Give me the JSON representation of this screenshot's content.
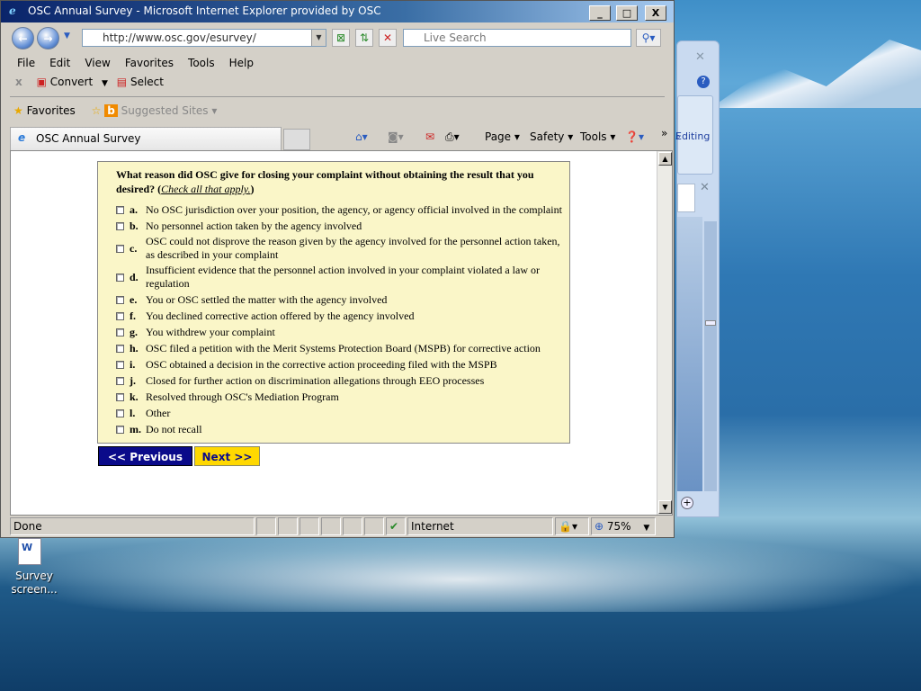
{
  "window": {
    "title": "OSC Annual Survey - Microsoft Internet Explorer provided by OSC",
    "minimize": "_",
    "maximize": "□",
    "close": "X"
  },
  "address": {
    "url": "http://www.osc.gov/esurvey/",
    "search_placeholder": "Live Search"
  },
  "menu": [
    "File",
    "Edit",
    "View",
    "Favorites",
    "Tools",
    "Help"
  ],
  "toolbar2": {
    "close": "x",
    "convert": "Convert",
    "select": "Select"
  },
  "favorites": {
    "label": "Favorites",
    "suggested": "Suggested Sites ▾"
  },
  "tab": {
    "label": "OSC Annual Survey"
  },
  "commands": {
    "page": "Page ▾",
    "safety": "Safety ▾",
    "tools": "Tools ▾",
    "more": "»"
  },
  "survey": {
    "question": "What reason did OSC give for closing your complaint without obtaining the result that you desired?",
    "hint": "Check all that apply.",
    "options": [
      {
        "letter": "a.",
        "text": "No OSC jurisdiction over your position, the agency, or agency official involved in the complaint"
      },
      {
        "letter": "b.",
        "text": "No personnel action taken by the agency involved"
      },
      {
        "letter": "c.",
        "text": "OSC could not disprove the reason given by the agency involved for the personnel action taken, as described in your complaint"
      },
      {
        "letter": "d.",
        "text": "Insufficient evidence that the personnel action involved in your complaint violated a law or regulation"
      },
      {
        "letter": "e.",
        "text": "You or OSC settled the matter with the agency involved"
      },
      {
        "letter": "f.",
        "text": "You declined corrective action offered by the agency involved"
      },
      {
        "letter": "g.",
        "text": "You withdrew your complaint"
      },
      {
        "letter": "h.",
        "text": "OSC filed a petition with the Merit Systems Protection Board (MSPB) for corrective action"
      },
      {
        "letter": "i.",
        "text": "OSC obtained a decision in the corrective action proceeding filed with the MSPB"
      },
      {
        "letter": "j.",
        "text": "Closed for further action on discrimination allegations through EEO processes"
      },
      {
        "letter": "k.",
        "text": "Resolved through OSC's Mediation Program"
      },
      {
        "letter": "l.",
        "text": "Other"
      },
      {
        "letter": "m.",
        "text": "Do not recall"
      }
    ],
    "prev": "<< Previous",
    "next": "Next >>"
  },
  "status": {
    "text": "Done",
    "zone": "Internet",
    "zoom": "75%"
  },
  "word": {
    "editing": "Editing"
  },
  "desktop": {
    "icon_label": "Survey screen..."
  }
}
